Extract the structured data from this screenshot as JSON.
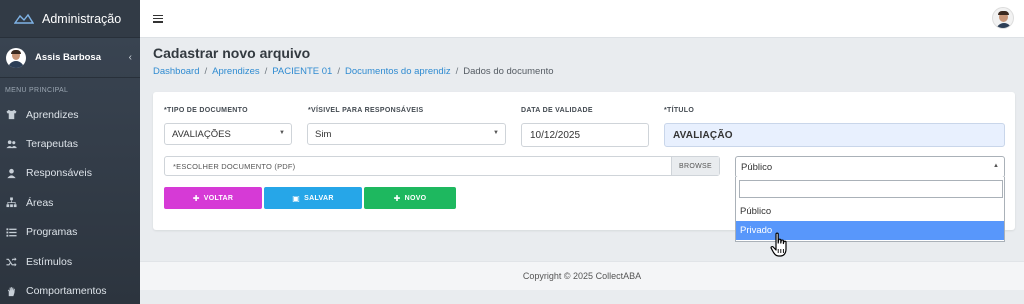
{
  "brand": {
    "title": "Administração"
  },
  "user": {
    "name": "Assis Barbosa",
    "collapse_glyph": "‹"
  },
  "sidebar": {
    "menu_title": "MENU PRINCIPAL",
    "items": [
      {
        "label": "Aprendizes",
        "icon": "tshirt-icon"
      },
      {
        "label": "Terapeutas",
        "icon": "users-icon"
      },
      {
        "label": "Responsáveis",
        "icon": "user-icon"
      },
      {
        "label": "Áreas",
        "icon": "sitemap-icon"
      },
      {
        "label": "Programas",
        "icon": "list-icon"
      },
      {
        "label": "Estímulos",
        "icon": "shuffle-icon"
      },
      {
        "label": "Comportamentos",
        "icon": "hand-icon"
      }
    ]
  },
  "page": {
    "title": "Cadastrar novo arquivo",
    "breadcrumb": [
      "Dashboard",
      "Aprendizes",
      "PACIENTE 01",
      "Documentos do aprendiz"
    ],
    "breadcrumb_current": "Dados do documento"
  },
  "form": {
    "tipo_label": "*TIPO DE DOCUMENTO",
    "tipo_value": "AVALIAÇÕES",
    "visivel_label": "*VÍSIVEL PARA RESPONSÁVEIS",
    "visivel_value": "Sim",
    "validade_label": "DATA DE VALIDADE",
    "validade_value": "10/12/2025",
    "titulo_label": "*TÍTULO",
    "titulo_value": "AVALIAÇÃO",
    "file_placeholder": "*ESCOLHER DOCUMENTO (PDF)",
    "browse_label": "BROWSE",
    "visibility_selected": "Público",
    "visibility_options": [
      "Público",
      "Privado"
    ],
    "visibility_highlighted": "Privado"
  },
  "buttons": {
    "voltar": "VOLTAR",
    "salvar": "SALVAR",
    "novo": "NOVO"
  },
  "footer": {
    "text": "Copyright © 2025 CollectABA"
  },
  "colors": {
    "voltar": "#d63ad6",
    "salvar": "#26a6e8",
    "novo": "#1eb85f",
    "highlight": "#5897fb",
    "link": "#2f8bd1"
  }
}
